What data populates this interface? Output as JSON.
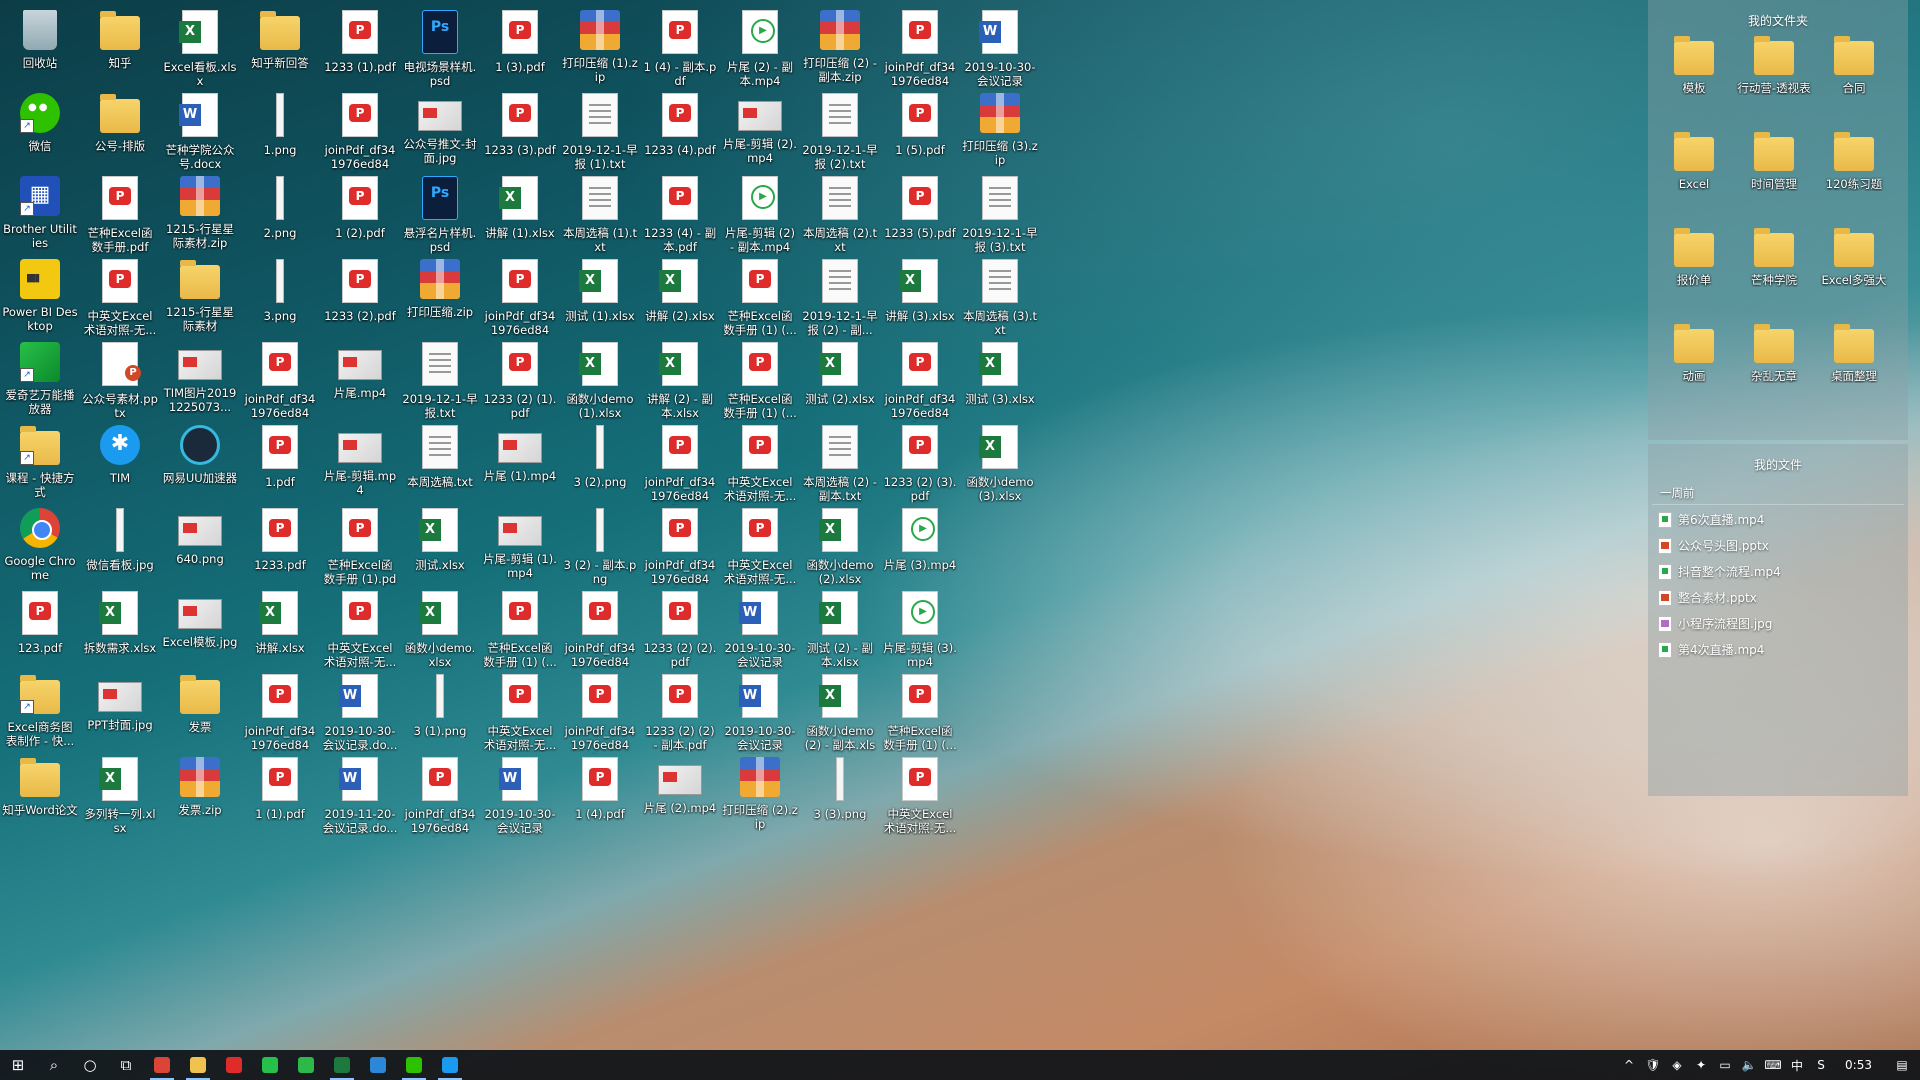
{
  "desktop": {
    "columns": [
      [
        {
          "label": "回收站",
          "type": "recycle",
          "icon": "recycle-bin-icon"
        },
        {
          "label": "微信",
          "type": "wechat",
          "icon": "wechat-icon",
          "shortcut": true
        },
        {
          "label": "Brother Utilities",
          "type": "brother",
          "icon": "brother-utilities-icon",
          "shortcut": true
        },
        {
          "label": "Power BI Desktop",
          "type": "powerbi",
          "icon": "power-bi-icon"
        },
        {
          "label": "爱奇艺万能播放器",
          "type": "green",
          "icon": "iqiyi-player-icon",
          "shortcut": true
        },
        {
          "label": "课程 - 快捷方式",
          "type": "folder",
          "icon": "folder-shortcut-icon",
          "shortcut": true
        },
        {
          "label": "Google Chrome",
          "type": "chrome",
          "icon": "chrome-icon"
        },
        {
          "label": "123.pdf",
          "type": "pdf",
          "icon": "pdf-file-icon"
        },
        {
          "label": "Excel商务图表制作 - 快...",
          "type": "folder",
          "icon": "folder-shortcut-icon",
          "shortcut": true
        },
        {
          "label": "知乎Word论文",
          "type": "folder",
          "icon": "folder-icon"
        }
      ],
      [
        {
          "label": "知乎",
          "type": "folder",
          "icon": "folder-icon"
        },
        {
          "label": "公号-排版",
          "type": "folder",
          "icon": "folder-icon"
        },
        {
          "label": "芒种Excel函数手册.pdf",
          "type": "pdf",
          "icon": "pdf-file-icon"
        },
        {
          "label": "中英文Excel术语对照-无...",
          "type": "pdf",
          "icon": "pdf-file-icon"
        },
        {
          "label": "公众号素材.pptx",
          "type": "pptx",
          "icon": "pptx-file-icon"
        },
        {
          "label": "TIM",
          "type": "tim",
          "icon": "tim-icon"
        },
        {
          "label": "微信看板.jpg",
          "type": "png",
          "icon": "image-file-icon"
        },
        {
          "label": "拆数需求.xlsx",
          "type": "xls",
          "icon": "excel-file-icon"
        },
        {
          "label": "PPT封面.jpg",
          "type": "img",
          "icon": "image-file-icon"
        },
        {
          "label": "多列转一列.xlsx",
          "type": "xls",
          "icon": "excel-file-icon"
        }
      ],
      [
        {
          "label": "Excel看板.xlsx",
          "type": "xls",
          "icon": "excel-file-icon"
        },
        {
          "label": "芒种学院公众号.docx",
          "type": "word",
          "icon": "word-file-icon"
        },
        {
          "label": "1215-行星星际素材.zip",
          "type": "zip",
          "icon": "zip-file-icon"
        },
        {
          "label": "1215-行星星际素材",
          "type": "folder",
          "icon": "folder-icon"
        },
        {
          "label": "TIM图片20191225073...",
          "type": "img",
          "icon": "image-file-icon"
        },
        {
          "label": "网易UU加速器",
          "type": "uu",
          "icon": "uu-accelerator-icon"
        },
        {
          "label": "640.png",
          "type": "img",
          "icon": "image-file-icon"
        },
        {
          "label": "Excel模板.jpg",
          "type": "img",
          "icon": "image-file-icon"
        },
        {
          "label": "发票",
          "type": "folder",
          "icon": "folder-icon"
        },
        {
          "label": "发票.zip",
          "type": "zip",
          "icon": "zip-file-icon"
        }
      ],
      [
        {
          "label": "知乎新回答",
          "type": "folder",
          "icon": "folder-icon"
        },
        {
          "label": "1.png",
          "type": "png",
          "icon": "image-file-icon"
        },
        {
          "label": "2.png",
          "type": "png",
          "icon": "image-file-icon"
        },
        {
          "label": "3.png",
          "type": "png",
          "icon": "image-file-icon"
        },
        {
          "label": "joinPdf_df341976ed843...",
          "type": "pdf",
          "icon": "pdf-file-icon"
        },
        {
          "label": "1.pdf",
          "type": "pdf",
          "icon": "pdf-file-icon"
        },
        {
          "label": "1233.pdf",
          "type": "pdf",
          "icon": "pdf-file-icon"
        },
        {
          "label": "讲解.xlsx",
          "type": "xls",
          "icon": "excel-file-icon"
        },
        {
          "label": "joinPdf_df341976ed843...",
          "type": "pdf",
          "icon": "pdf-file-icon"
        },
        {
          "label": "1 (1).pdf",
          "type": "pdf",
          "icon": "pdf-file-icon"
        }
      ],
      [
        {
          "label": "1233 (1).pdf",
          "type": "pdf",
          "icon": "pdf-file-icon"
        },
        {
          "label": "joinPdf_df341976ed843...",
          "type": "pdf",
          "icon": "pdf-file-icon"
        },
        {
          "label": "1 (2).pdf",
          "type": "pdf",
          "icon": "pdf-file-icon"
        },
        {
          "label": "1233 (2).pdf",
          "type": "pdf",
          "icon": "pdf-file-icon"
        },
        {
          "label": "片尾.mp4",
          "type": "img",
          "icon": "video-file-icon"
        },
        {
          "label": "片尾-剪辑.mp4",
          "type": "img",
          "icon": "video-file-icon"
        },
        {
          "label": "芒种Excel函数手册 (1).pdf",
          "type": "pdf",
          "icon": "pdf-file-icon"
        },
        {
          "label": "中英文Excel术语对照-无...",
          "type": "pdf",
          "icon": "pdf-file-icon"
        },
        {
          "label": "2019-10-30-会议记录.do...",
          "type": "word",
          "icon": "word-file-icon"
        },
        {
          "label": "2019-11-20-会议记录.do...",
          "type": "word",
          "icon": "word-file-icon"
        }
      ],
      [
        {
          "label": "电视场景样机.psd",
          "type": "psd",
          "icon": "psd-file-icon"
        },
        {
          "label": "公众号推文-封面.jpg",
          "type": "img",
          "icon": "image-file-icon"
        },
        {
          "label": "悬浮名片样机.psd",
          "type": "psd",
          "icon": "psd-file-icon"
        },
        {
          "label": "打印压缩.zip",
          "type": "zip",
          "icon": "zip-file-icon"
        },
        {
          "label": "2019-12-1-早报.txt",
          "type": "txt",
          "icon": "text-file-icon"
        },
        {
          "label": "本周选稿.txt",
          "type": "txt",
          "icon": "text-file-icon"
        },
        {
          "label": "测试.xlsx",
          "type": "xls",
          "icon": "excel-file-icon"
        },
        {
          "label": "函数小demo.xlsx",
          "type": "xls",
          "icon": "excel-file-icon"
        },
        {
          "label": "3 (1).png",
          "type": "png",
          "icon": "image-file-icon"
        },
        {
          "label": "joinPdf_df341976ed843...",
          "type": "pdf",
          "icon": "pdf-file-icon"
        }
      ],
      [
        {
          "label": "1 (3).pdf",
          "type": "pdf",
          "icon": "pdf-file-icon"
        },
        {
          "label": "1233 (3).pdf",
          "type": "pdf",
          "icon": "pdf-file-icon"
        },
        {
          "label": "讲解 (1).xlsx",
          "type": "xls",
          "icon": "excel-file-icon"
        },
        {
          "label": "joinPdf_df341976ed843...",
          "type": "pdf",
          "icon": "pdf-file-icon"
        },
        {
          "label": "1233 (2) (1).pdf",
          "type": "pdf",
          "icon": "pdf-file-icon"
        },
        {
          "label": "片尾 (1).mp4",
          "type": "img",
          "icon": "video-file-icon"
        },
        {
          "label": "片尾-剪辑 (1).mp4",
          "type": "img",
          "icon": "video-file-icon"
        },
        {
          "label": "芒种Excel函数手册 (1) (...",
          "type": "pdf",
          "icon": "pdf-file-icon"
        },
        {
          "label": "中英文Excel术语对照-无...",
          "type": "pdf",
          "icon": "pdf-file-icon"
        },
        {
          "label": "2019-10-30-会议记录 (1)...",
          "type": "word",
          "icon": "word-file-icon"
        }
      ],
      [
        {
          "label": "打印压缩 (1).zip",
          "type": "zip",
          "icon": "zip-file-icon"
        },
        {
          "label": "2019-12-1-早报 (1).txt",
          "type": "txt",
          "icon": "text-file-icon"
        },
        {
          "label": "本周选稿 (1).txt",
          "type": "txt",
          "icon": "text-file-icon"
        },
        {
          "label": "测试 (1).xlsx",
          "type": "xls",
          "icon": "excel-file-icon"
        },
        {
          "label": "函数小demo (1).xlsx",
          "type": "xls",
          "icon": "excel-file-icon"
        },
        {
          "label": "3 (2).png",
          "type": "png",
          "icon": "image-file-icon"
        },
        {
          "label": "3 (2) - 副本.png",
          "type": "png",
          "icon": "image-file-icon"
        },
        {
          "label": "joinPdf_df341976ed843...",
          "type": "pdf",
          "icon": "pdf-file-icon"
        },
        {
          "label": "joinPdf_df341976ed843...",
          "type": "pdf",
          "icon": "pdf-file-icon"
        },
        {
          "label": "1 (4).pdf",
          "type": "pdf",
          "icon": "pdf-file-icon"
        }
      ],
      [
        {
          "label": "1 (4) - 副本.pdf",
          "type": "pdf",
          "icon": "pdf-file-icon"
        },
        {
          "label": "1233 (4).pdf",
          "type": "pdf",
          "icon": "pdf-file-icon"
        },
        {
          "label": "1233 (4) - 副本.pdf",
          "type": "pdf",
          "icon": "pdf-file-icon"
        },
        {
          "label": "讲解 (2).xlsx",
          "type": "xls",
          "icon": "excel-file-icon"
        },
        {
          "label": "讲解 (2) - 副本.xlsx",
          "type": "xls",
          "icon": "excel-file-icon"
        },
        {
          "label": "joinPdf_df341976ed843...",
          "type": "pdf",
          "icon": "pdf-file-icon"
        },
        {
          "label": "joinPdf_df341976ed843...",
          "type": "pdf",
          "icon": "pdf-file-icon"
        },
        {
          "label": "1233 (2) (2).pdf",
          "type": "pdf",
          "icon": "pdf-file-icon"
        },
        {
          "label": "1233 (2) (2) - 副本.pdf",
          "type": "pdf",
          "icon": "pdf-file-icon"
        },
        {
          "label": "片尾 (2).mp4",
          "type": "img",
          "icon": "video-file-icon"
        }
      ],
      [
        {
          "label": "片尾 (2) - 副本.mp4",
          "type": "mp4",
          "icon": "video-file-icon"
        },
        {
          "label": "片尾-剪辑 (2).mp4",
          "type": "img",
          "icon": "video-file-icon"
        },
        {
          "label": "片尾-剪辑 (2) - 副本.mp4",
          "type": "mp4",
          "icon": "video-file-icon"
        },
        {
          "label": "芒种Excel函数手册 (1) (...",
          "type": "pdf",
          "icon": "pdf-file-icon"
        },
        {
          "label": "芒种Excel函数手册 (1) (...",
          "type": "pdf",
          "icon": "pdf-file-icon"
        },
        {
          "label": "中英文Excel术语对照-无...",
          "type": "pdf",
          "icon": "pdf-file-icon"
        },
        {
          "label": "中英文Excel术语对照-无...",
          "type": "pdf",
          "icon": "pdf-file-icon"
        },
        {
          "label": "2019-10-30-会议记录 (2)...",
          "type": "word",
          "icon": "word-file-icon"
        },
        {
          "label": "2019-10-30-会议记录 (2)...",
          "type": "word",
          "icon": "word-file-icon"
        },
        {
          "label": "打印压缩 (2).zip",
          "type": "zip",
          "icon": "zip-file-icon"
        }
      ],
      [
        {
          "label": "打印压缩 (2) - 副本.zip",
          "type": "zip",
          "icon": "zip-file-icon"
        },
        {
          "label": "2019-12-1-早报 (2).txt",
          "type": "txt",
          "icon": "text-file-icon"
        },
        {
          "label": "本周选稿 (2).txt",
          "type": "txt",
          "icon": "text-file-icon"
        },
        {
          "label": "2019-12-1-早报 (2) - 副...",
          "type": "txt",
          "icon": "text-file-icon"
        },
        {
          "label": "测试 (2).xlsx",
          "type": "xls",
          "icon": "excel-file-icon"
        },
        {
          "label": "本周选稿 (2) - 副本.txt",
          "type": "txt",
          "icon": "text-file-icon"
        },
        {
          "label": "函数小demo (2).xlsx",
          "type": "xls",
          "icon": "excel-file-icon"
        },
        {
          "label": "测试 (2) - 副本.xlsx",
          "type": "xls",
          "icon": "excel-file-icon"
        },
        {
          "label": "函数小demo (2) - 副本.xlsx",
          "type": "xls",
          "icon": "excel-file-icon"
        },
        {
          "label": "3 (3).png",
          "type": "png",
          "icon": "image-file-icon"
        }
      ],
      [
        {
          "label": "joinPdf_df341976ed843...",
          "type": "pdf",
          "icon": "pdf-file-icon"
        },
        {
          "label": "1 (5).pdf",
          "type": "pdf",
          "icon": "pdf-file-icon"
        },
        {
          "label": "1233 (5).pdf",
          "type": "pdf",
          "icon": "pdf-file-icon"
        },
        {
          "label": "讲解 (3).xlsx",
          "type": "xls",
          "icon": "excel-file-icon"
        },
        {
          "label": "joinPdf_df341976ed843...",
          "type": "pdf",
          "icon": "pdf-file-icon"
        },
        {
          "label": "1233 (2) (3).pdf",
          "type": "pdf",
          "icon": "pdf-file-icon"
        },
        {
          "label": "片尾 (3).mp4",
          "type": "mp4",
          "icon": "video-file-icon"
        },
        {
          "label": "片尾-剪辑 (3).mp4",
          "type": "mp4",
          "icon": "video-file-icon"
        },
        {
          "label": "芒种Excel函数手册 (1) (...",
          "type": "pdf",
          "icon": "pdf-file-icon"
        },
        {
          "label": "中英文Excel术语对照-无...",
          "type": "pdf",
          "icon": "pdf-file-icon"
        }
      ],
      [
        {
          "label": "2019-10-30-会议记录 (3)...",
          "type": "word",
          "icon": "word-file-icon"
        },
        {
          "label": "打印压缩 (3).zip",
          "type": "zip",
          "icon": "zip-file-icon"
        },
        {
          "label": "2019-12-1-早报 (3).txt",
          "type": "txt",
          "icon": "text-file-icon"
        },
        {
          "label": "本周选稿 (3).txt",
          "type": "txt",
          "icon": "text-file-icon"
        },
        {
          "label": "测试 (3).xlsx",
          "type": "xls",
          "icon": "excel-file-icon"
        },
        {
          "label": "函数小demo (3).xlsx",
          "type": "xls",
          "icon": "excel-file-icon"
        }
      ]
    ]
  },
  "folders_panel": {
    "title": "我的文件夹",
    "items": [
      {
        "label": "模板",
        "icon": "folder-icon"
      },
      {
        "label": "行动营-透视表",
        "icon": "folder-icon"
      },
      {
        "label": "合同",
        "icon": "folder-icon"
      },
      {
        "label": "Excel",
        "icon": "folder-icon"
      },
      {
        "label": "时间管理",
        "icon": "folder-icon"
      },
      {
        "label": "120练习题",
        "icon": "folder-icon"
      },
      {
        "label": "报价单",
        "icon": "folder-icon"
      },
      {
        "label": "芒种学院",
        "icon": "folder-icon"
      },
      {
        "label": "Excel多强大",
        "icon": "folder-icon"
      },
      {
        "label": "动画",
        "icon": "folder-icon"
      },
      {
        "label": "杂乱无章",
        "icon": "folder-icon"
      },
      {
        "label": "桌面整理",
        "icon": "folder-icon"
      }
    ]
  },
  "files_panel": {
    "title": "我的文件",
    "section": "一周前",
    "items": [
      {
        "label": "第6次直播.mp4",
        "kind": "mp4"
      },
      {
        "label": "公众号头图.pptx",
        "kind": "pptx"
      },
      {
        "label": "抖音整个流程.mp4",
        "kind": "mp4"
      },
      {
        "label": "整合素材.pptx",
        "kind": "pptx"
      },
      {
        "label": "小程序流程图.jpg",
        "kind": "jpg"
      },
      {
        "label": "第4次直播.mp4",
        "kind": "mp4"
      }
    ]
  },
  "taskbar": {
    "start_label": "⊞",
    "search_label": "⌕",
    "cortana_label": "○",
    "taskview_label": "⧉",
    "apps": [
      {
        "name": "chrome-taskbar",
        "color": "#db4437",
        "active": true
      },
      {
        "name": "file-explorer-taskbar",
        "color": "#f0c34f",
        "active": true
      },
      {
        "name": "pdf-reader-taskbar",
        "color": "#e02b2b",
        "active": false
      },
      {
        "name": "iqiyi-taskbar",
        "color": "#27c04a",
        "active": false
      },
      {
        "name": "green-app-taskbar",
        "color": "#2db84a",
        "active": false
      },
      {
        "name": "excel-taskbar",
        "color": "#1d7a3f",
        "active": true
      },
      {
        "name": "photo-app-taskbar",
        "color": "#2b88d8",
        "active": false
      },
      {
        "name": "wechat-taskbar",
        "color": "#2dc100",
        "active": true
      },
      {
        "name": "blue-app-taskbar",
        "color": "#1b9bf0",
        "active": true
      }
    ],
    "tray": {
      "chevron": "^",
      "ime": "中",
      "clock": "0:53"
    }
  }
}
